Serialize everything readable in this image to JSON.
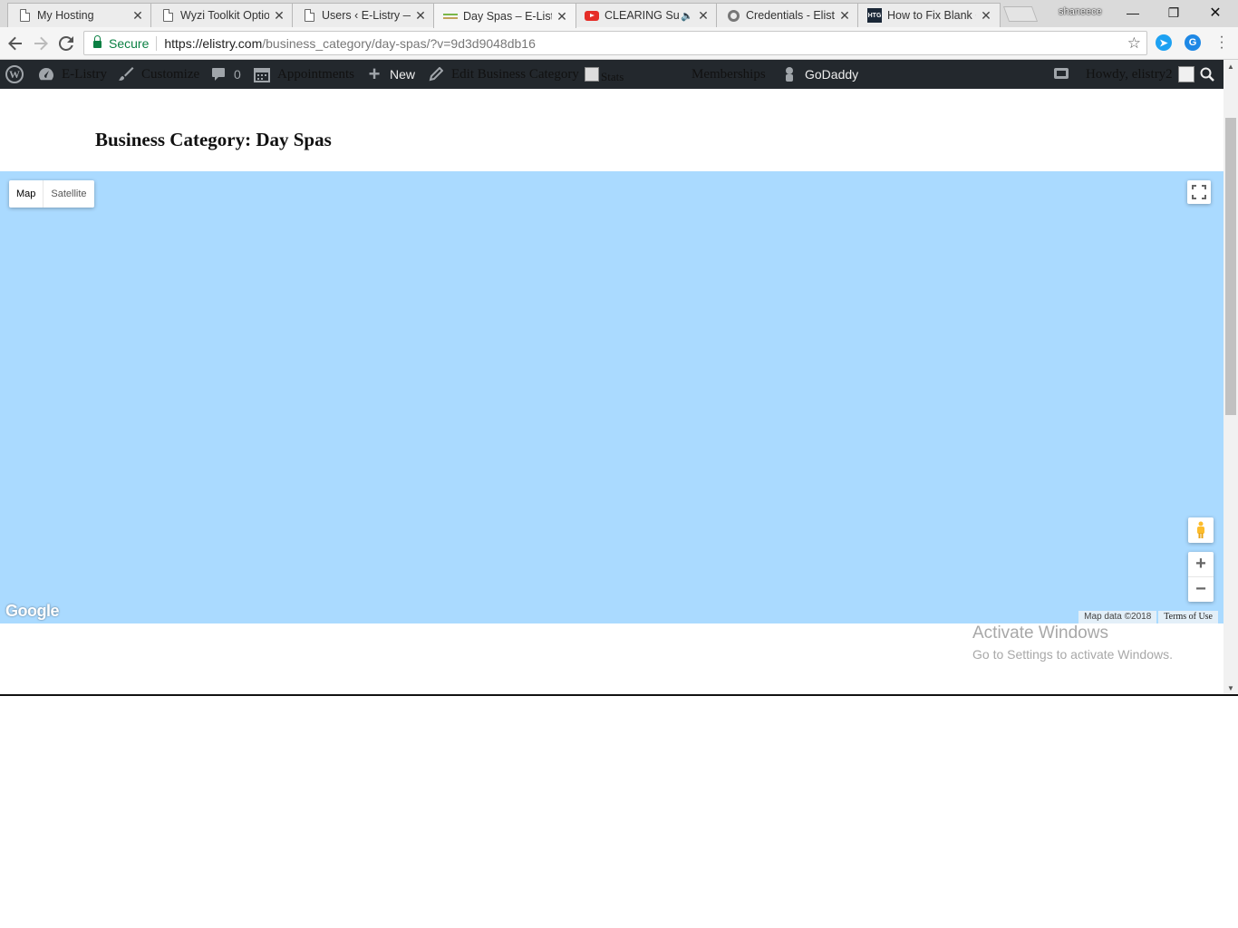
{
  "browser": {
    "tabs": [
      {
        "title": "My Hosting",
        "icon": "document-icon"
      },
      {
        "title": "Wyzi Toolkit Optio",
        "icon": "document-icon"
      },
      {
        "title": "Users ‹ E-Listry —",
        "icon": "document-icon"
      },
      {
        "title": "Day Spas – E-Listr",
        "icon": "spa-favicon",
        "active": true
      },
      {
        "title": "CLEARING Sub",
        "icon": "youtube-icon",
        "audio": true
      },
      {
        "title": "Credentials - Elistr",
        "icon": "gear-icon"
      },
      {
        "title": "How to Fix Blank C",
        "icon": "htg-icon"
      }
    ],
    "tab_close": "✕",
    "profile_name": "shaneece",
    "window_controls": {
      "minimize": "—",
      "restore": "❐",
      "close": "✕"
    },
    "secure_label": "Secure",
    "url_host": "https://elistry.com",
    "url_path": "/business_category/day-spas/?v=9d3d9048db16"
  },
  "admin_bar": {
    "site_name": "E-Listry",
    "customize": "Customize",
    "comments_count": "0",
    "appointments": "Appointments",
    "new": "New",
    "edit_category": "Edit Business Category",
    "stats": "Stats",
    "memberships": "Memberships",
    "godaddy": "GoDaddy",
    "howdy": "Howdy, elistry2"
  },
  "page": {
    "title": "Business Category: Day Spas"
  },
  "map": {
    "type_map": "Map",
    "type_satellite": "Satellite",
    "zoom_in": "+",
    "zoom_out": "−",
    "google_logo": "Google",
    "map_data": "Map data ©2018",
    "terms": "Terms of Use",
    "background_color": "#aadaff"
  },
  "watermark": {
    "line1": "Activate Windows",
    "line2": "Go to Settings to activate Windows."
  }
}
